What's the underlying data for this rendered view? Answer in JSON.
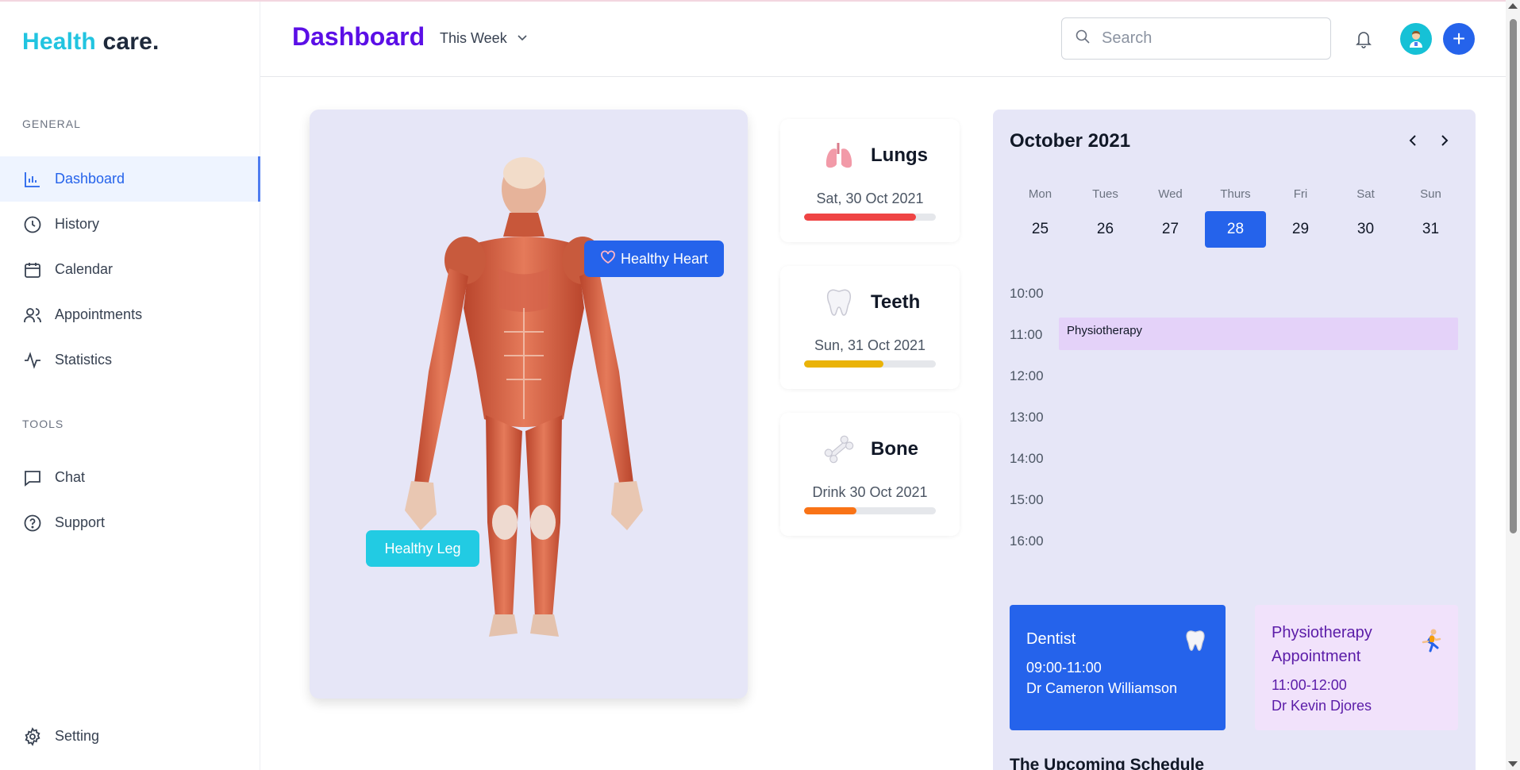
{
  "brand": {
    "part1": "Health",
    "part2": "care."
  },
  "sidebar": {
    "general_label": "GENERAL",
    "tools_label": "TOOLS",
    "items": [
      {
        "label": "Dashboard",
        "icon": "bar-chart-icon",
        "active": true
      },
      {
        "label": "History",
        "icon": "clock-icon"
      },
      {
        "label": "Calendar",
        "icon": "calendar-icon"
      },
      {
        "label": "Appointments",
        "icon": "users-icon"
      },
      {
        "label": "Statistics",
        "icon": "activity-icon"
      }
    ],
    "tools": [
      {
        "label": "Chat",
        "icon": "chat-icon"
      },
      {
        "label": "Support",
        "icon": "help-circle-icon"
      }
    ],
    "setting": {
      "label": "Setting",
      "icon": "gear-icon"
    }
  },
  "header": {
    "title": "Dashboard",
    "period": "This Week",
    "search_placeholder": "Search",
    "add_label": "+"
  },
  "body_card": {
    "heart_tag": "Healthy Heart",
    "leg_tag": "Healthy Leg"
  },
  "organs": [
    {
      "name": "Lungs",
      "date": "Sat, 30 Oct 2021",
      "progress": 0.85,
      "color": "#ef4444",
      "icon": "lungs-icon"
    },
    {
      "name": "Teeth",
      "date": "Sun, 31 Oct 2021",
      "progress": 0.6,
      "color": "#eab308",
      "icon": "tooth-icon"
    },
    {
      "name": "Bone",
      "date": "Drink 30 Oct 2021",
      "progress": 0.4,
      "color": "#f97316",
      "icon": "bone-icon"
    }
  ],
  "calendar": {
    "month": "October 2021",
    "days": [
      {
        "name": "Mon",
        "date": "25"
      },
      {
        "name": "Tues",
        "date": "26"
      },
      {
        "name": "Wed",
        "date": "27"
      },
      {
        "name": "Thurs",
        "date": "28",
        "selected": true
      },
      {
        "name": "Fri",
        "date": "29"
      },
      {
        "name": "Sat",
        "date": "30"
      },
      {
        "name": "Sun",
        "date": "31"
      }
    ],
    "times": [
      "10:00",
      "11:00",
      "12:00",
      "13:00",
      "14:00",
      "15:00",
      "16:00"
    ],
    "event": "Physiotherapy"
  },
  "appointments": [
    {
      "title": "Dentist",
      "time": "09:00-11:00",
      "doctor": "Dr Cameron Williamson",
      "icon": "tooth-icon"
    },
    {
      "title": "Physiotherapy Appointment",
      "time": "11:00-12:00",
      "doctor": "Dr Kevin Djores",
      "icon": "runner-icon"
    }
  ],
  "upcoming_title": "The Upcoming Schedule"
}
